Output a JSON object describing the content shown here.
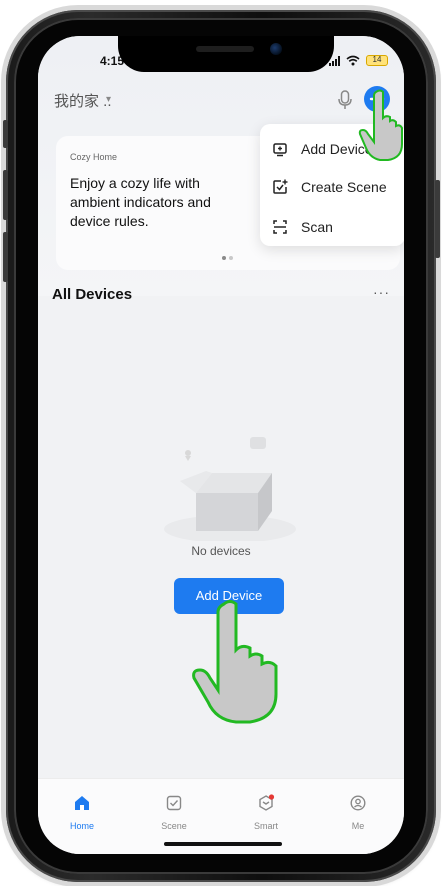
{
  "status_bar": {
    "time": "4:15",
    "battery": "14"
  },
  "topbar": {
    "home_name": "我的家 ..",
    "caret": "▾"
  },
  "banner": {
    "tag": "Cozy Home",
    "text": "Enjoy a cozy life with ambient indicators and device rules."
  },
  "menu": {
    "items": [
      {
        "label": "Add Device",
        "icon": "add-device-icon"
      },
      {
        "label": "Create Scene",
        "icon": "create-scene-icon"
      },
      {
        "label": "Scan",
        "icon": "scan-icon"
      }
    ]
  },
  "section": {
    "title": "All Devices",
    "more": "···"
  },
  "empty": {
    "text": "No devices",
    "button": "Add Device"
  },
  "tabs": [
    {
      "label": "Home",
      "icon": "home-icon",
      "active": true
    },
    {
      "label": "Scene",
      "icon": "scene-icon",
      "active": false
    },
    {
      "label": "Smart",
      "icon": "smart-icon",
      "active": false
    },
    {
      "label": "Me",
      "icon": "me-icon",
      "active": false
    }
  ],
  "colors": {
    "accent": "#1e7bf0",
    "hand_outline": "#22b922",
    "hand_fill": "#c8c8c8",
    "badge": "#e53935"
  }
}
